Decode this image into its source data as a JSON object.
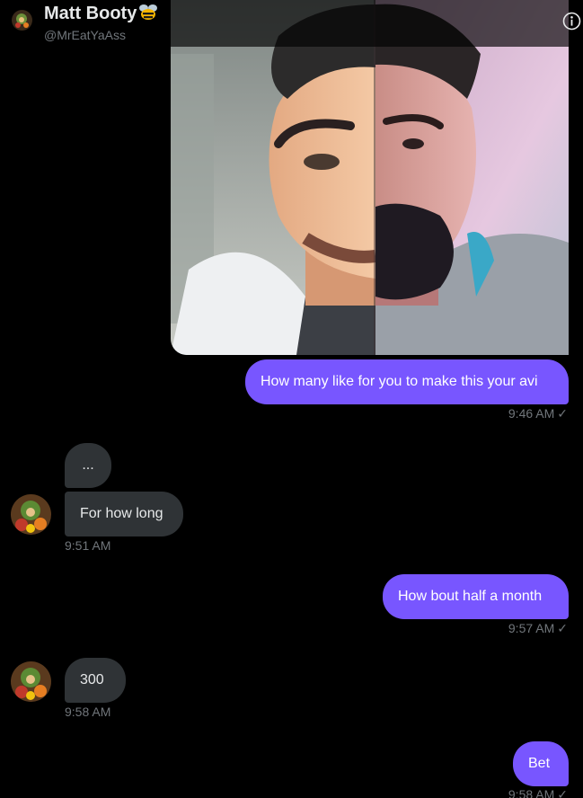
{
  "header": {
    "name": "Matt Booty",
    "handle": "@MrEatYaAss",
    "emoji_icon": "bee-icon",
    "info_icon": "info-icon"
  },
  "colors": {
    "sent_bubble": "#7856ff",
    "received_bubble": "#2f3336",
    "background": "#000000",
    "timestamp": "#71767b"
  },
  "messages": [
    {
      "side": "sent",
      "type": "image",
      "alt": "split face image"
    },
    {
      "side": "sent",
      "text": "How many like for you to make this your avi",
      "time": "9:46 AM"
    },
    {
      "side": "received",
      "text": "...",
      "time": ""
    },
    {
      "side": "received",
      "text": "For how long",
      "time": "9:51 AM"
    },
    {
      "side": "sent",
      "text": "How bout half a month",
      "time": "9:57 AM"
    },
    {
      "side": "received",
      "text": "300",
      "time": "9:58 AM"
    },
    {
      "side": "sent",
      "text": "Bet",
      "time": "9:58 AM"
    }
  ],
  "read_mark": "✓"
}
